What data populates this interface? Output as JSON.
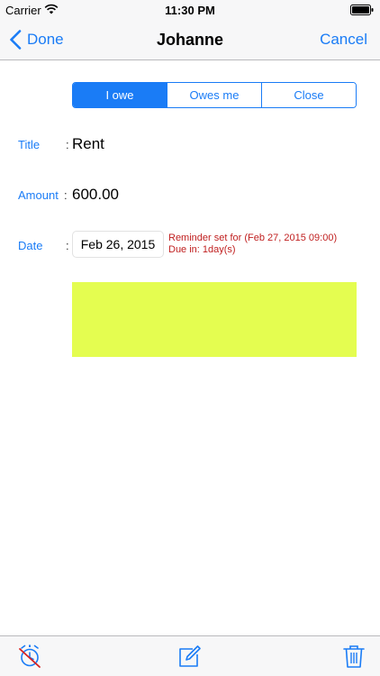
{
  "status_bar": {
    "carrier": "Carrier",
    "time": "11:30 PM"
  },
  "nav": {
    "back_label": "Done",
    "title": "Johanne",
    "cancel_label": "Cancel"
  },
  "segments": [
    {
      "label": "I owe",
      "selected": true
    },
    {
      "label": "Owes me",
      "selected": false
    },
    {
      "label": "Close",
      "selected": false
    }
  ],
  "form": {
    "title_label": "Title",
    "title_value": "Rent",
    "amount_label": "Amount",
    "amount_value": "600.00",
    "date_label": "Date",
    "date_value": "Feb 26, 2015",
    "colon": ":",
    "reminder_line1": "Reminder set for (Feb 27, 2015 09:00)",
    "reminder_line2": "Due in: 1day(s)"
  },
  "note": {
    "color": "#e4fd50"
  },
  "toolbar": {
    "icons": [
      "alarm-off-icon",
      "edit-icon",
      "trash-icon"
    ]
  },
  "colors": {
    "accent": "#1a7cf6",
    "reminder": "#c01f1f"
  }
}
